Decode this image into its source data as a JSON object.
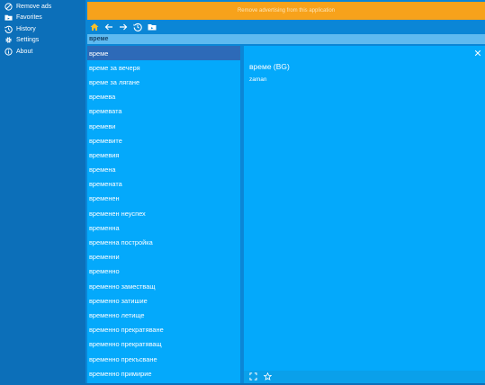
{
  "nav": {
    "items": [
      {
        "label": "Remove ads",
        "icon": "no-ads-icon"
      },
      {
        "label": "Favorites",
        "icon": "folder-icon"
      },
      {
        "label": "History",
        "icon": "history-icon"
      },
      {
        "label": "Settings",
        "icon": "gear-icon"
      },
      {
        "label": "About",
        "icon": "info-icon"
      }
    ]
  },
  "ad_banner": {
    "text": "Remove advertising from this application"
  },
  "toolbar": {
    "buttons": [
      "home-icon",
      "back-arrow-icon",
      "forward-arrow-icon",
      "history-icon",
      "folder-icon"
    ]
  },
  "search": {
    "value": "време"
  },
  "word_list": {
    "items": [
      "време",
      "време за вечеря",
      "време за лягане",
      "времева",
      "времевата",
      "времеви",
      "времевите",
      "времевия",
      "времена",
      "времената",
      "временен",
      "временен неуспех",
      "временна",
      "временна постройка",
      "временни",
      "временно",
      "временно заместващ",
      "временно затишие",
      "временно летище",
      "временно прекратяване",
      "временно прекратяващ",
      "временно прекъсване",
      "временно примирие"
    ],
    "selected_index": 0
  },
  "detail": {
    "title": "време (BG)",
    "text": "zaman"
  },
  "colors": {
    "nav_bg": "#0c6fb9",
    "banner": "#f7a21b",
    "panel": "#04a9fb",
    "selected": "#2d6ab8",
    "search": "#5fbaf0"
  }
}
